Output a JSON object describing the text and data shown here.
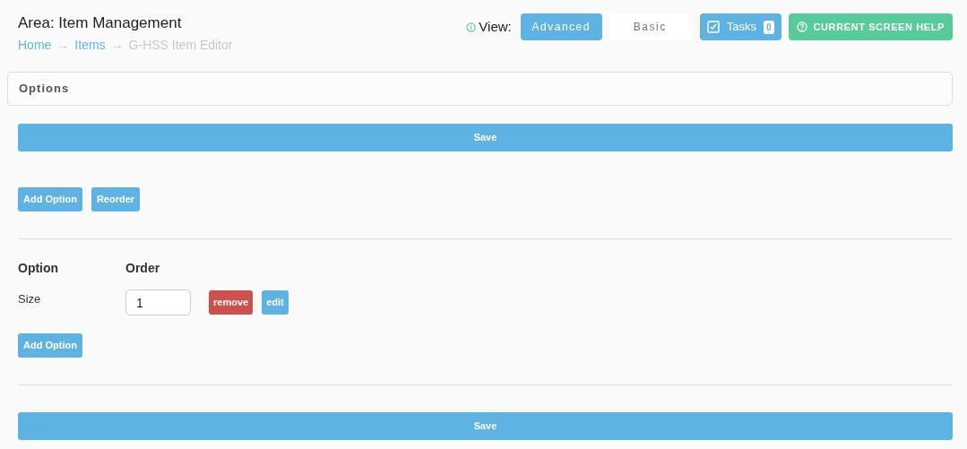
{
  "header": {
    "title": "Area: Item Management",
    "breadcrumb": [
      {
        "kind": "link",
        "label": "Home"
      },
      {
        "kind": "separator",
        "label": "→"
      },
      {
        "kind": "link",
        "label": "Items"
      },
      {
        "kind": "separator",
        "label": "→"
      },
      {
        "kind": "current",
        "label": "G-HSS Item Editor"
      }
    ]
  },
  "view": {
    "label": "View:",
    "options": [
      {
        "label": "Advanced",
        "selected": true
      },
      {
        "label": "Basic",
        "selected": false
      }
    ]
  },
  "tasks": {
    "label": "Tasks",
    "count": "0"
  },
  "help_button": "CURRENT SCREEN HELP",
  "panel": {
    "title": "Options"
  },
  "save_top": "Save",
  "toolbar": [
    "Add Option",
    "Reorder"
  ],
  "table": {
    "columns": [
      "Option",
      "Order"
    ],
    "rows": [
      {
        "option": "Size",
        "order": "1",
        "actions": [
          {
            "kind": "danger",
            "label": "remove"
          },
          {
            "kind": "primary",
            "label": "edit"
          }
        ]
      }
    ]
  },
  "add_button": "Add Option",
  "save_bottom": "Save"
}
